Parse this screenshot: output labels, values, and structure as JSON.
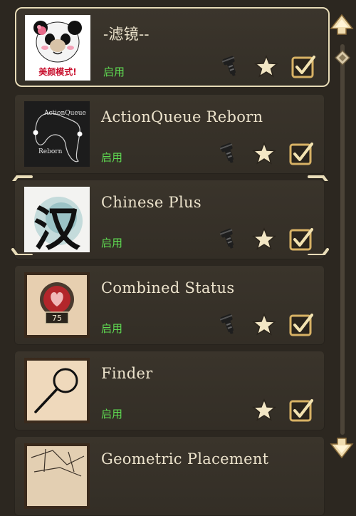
{
  "mods": [
    {
      "title": "-滤镜--",
      "status": "启用",
      "has_config": true,
      "favorite": true,
      "enabled": true,
      "selected": true,
      "thumb_text": "美颜模式!",
      "thumb_icon": "panda-meme-icon"
    },
    {
      "title": "ActionQueue Reborn",
      "status": "启用",
      "has_config": true,
      "favorite": true,
      "enabled": true,
      "thumb_text_top": "ActionQueue",
      "thumb_text_bottom": "Reborn",
      "thumb_icon": "actionqueue-diagram-icon"
    },
    {
      "title": "Chinese Plus",
      "status": "启用",
      "has_config": true,
      "favorite": true,
      "enabled": true,
      "highlighted": true,
      "thumb_text": "汉",
      "thumb_icon": "chinese-character-icon"
    },
    {
      "title": "Combined Status",
      "status": "启用",
      "has_config": true,
      "favorite": true,
      "enabled": true,
      "thumb_text": "75",
      "thumb_icon": "heart-badge-icon"
    },
    {
      "title": "Finder",
      "status": "启用",
      "has_config": false,
      "favorite": true,
      "enabled": true,
      "thumb_icon": "magnifier-icon"
    },
    {
      "title": "Geometric Placement",
      "thumb_icon": "geometric-map-icon"
    }
  ],
  "colors": {
    "status_green": "#5fdc52",
    "title_text": "#ece3cc",
    "star_gold": "#f2e6c4",
    "checkbox_gold": "#d8b265"
  },
  "scrollbar": {
    "up_icon": "scroll-up-arrow-icon",
    "down_icon": "scroll-down-arrow-icon"
  }
}
